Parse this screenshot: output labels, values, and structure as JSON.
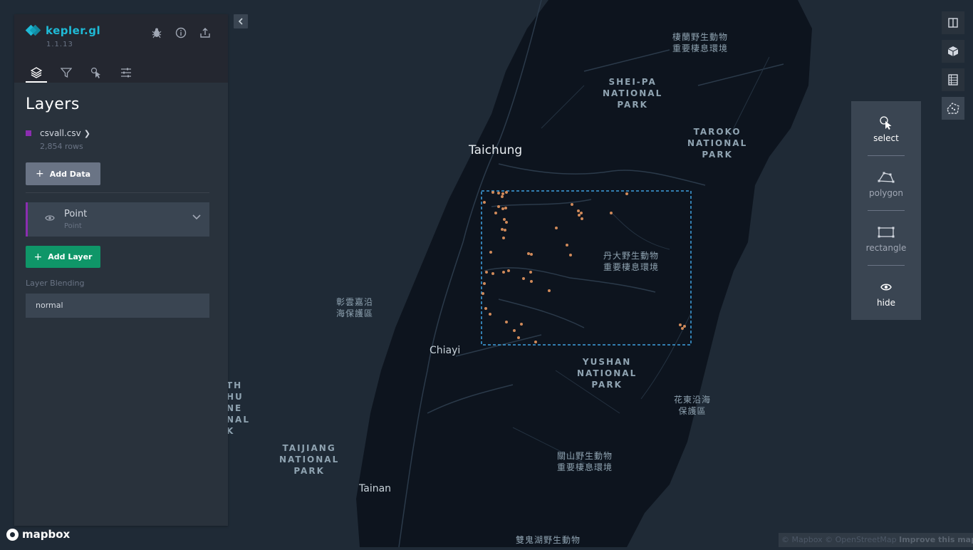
{
  "app": {
    "name": "kepler.gl",
    "version": "1.1.13"
  },
  "header_icons": [
    "bug-icon",
    "info-icon",
    "share-icon"
  ],
  "tabs": [
    {
      "name": "layers-tab",
      "icon": "layers-icon",
      "active": true
    },
    {
      "name": "filters-tab",
      "icon": "filter-icon",
      "active": false
    },
    {
      "name": "interactions-tab",
      "icon": "cursor-icon",
      "active": false
    },
    {
      "name": "basemap-tab",
      "icon": "settings-icon",
      "active": false
    }
  ],
  "panel": {
    "title": "Layers",
    "dataset": {
      "name": "csvall.csv",
      "rows": "2,854 rows",
      "color": "#8b2db0"
    },
    "add_data_label": "Add Data",
    "layer": {
      "name": "Point",
      "type": "Point"
    },
    "add_layer_label": "Add Layer",
    "blending_label": "Layer Blending",
    "blending_value": "normal"
  },
  "draw_tools": {
    "select": "select",
    "polygon": "polygon",
    "rectangle": "rectangle",
    "hide": "hide"
  },
  "map_labels": {
    "taichung": "Taichung",
    "chiayi": "Chiayi",
    "tainan": "Tainan",
    "sheipa": "SHEI-PA\nNATIONAL\nPARK",
    "taroko": "TAROKO\nNATIONAL\nPARK",
    "yushan": "YUSHAN\nNATIONAL\nPARK",
    "taijiang": "TAIJIANG\nNATIONAL\nPARK",
    "partial_park": "TH\nHU\nNE\nNAL\nK",
    "cn1": "棲蘭野生動物\n重要棲息環境",
    "cn2": "丹大野生動物\n重要棲息環境",
    "cn3": "彰雲嘉沿\n海保護區",
    "cn4": "花東沿海\n保護區",
    "cn5": "關山野生動物\n重要棲息環境",
    "cn6": "雙鬼湖野生動物"
  },
  "attribution": {
    "mapbox": "mapbox",
    "copyright": "© Mapbox © OpenStreetMap",
    "improve": "Improve this map"
  },
  "colors": {
    "accent": "#1fbad6",
    "layer_color": "#8b2db0",
    "add_layer": "#0f9668",
    "points": "#d08a5a",
    "selection": "#3ea2e0"
  }
}
